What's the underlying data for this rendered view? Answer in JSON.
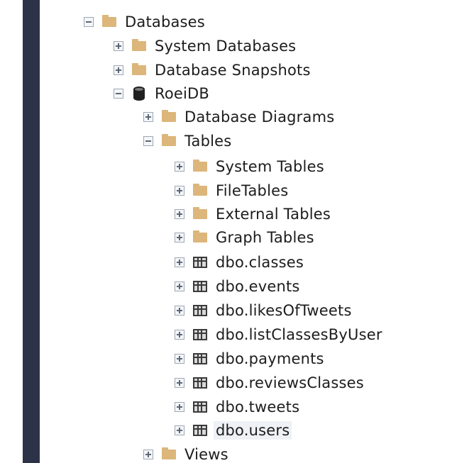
{
  "tree": {
    "databases": {
      "label": "Databases",
      "expanded": true,
      "icon": "folder-icon"
    },
    "system_databases": {
      "label": "System Databases",
      "expanded": false,
      "icon": "folder-icon"
    },
    "database_snapshots": {
      "label": "Database Snapshots",
      "expanded": false,
      "icon": "folder-icon"
    },
    "roeidb": {
      "label": "RoeiDB",
      "expanded": true,
      "icon": "database-icon"
    },
    "database_diagrams": {
      "label": "Database Diagrams",
      "expanded": false,
      "icon": "folder-icon"
    },
    "tables": {
      "label": "Tables",
      "expanded": true,
      "icon": "folder-icon"
    },
    "system_tables": {
      "label": "System Tables",
      "expanded": false,
      "icon": "folder-icon"
    },
    "file_tables": {
      "label": "FileTables",
      "expanded": false,
      "icon": "folder-icon"
    },
    "external_tables": {
      "label": "External Tables",
      "expanded": false,
      "icon": "folder-icon"
    },
    "graph_tables": {
      "label": "Graph Tables",
      "expanded": false,
      "icon": "folder-icon"
    },
    "user_tables": [
      {
        "label": "dbo.classes",
        "icon": "table-icon"
      },
      {
        "label": "dbo.events",
        "icon": "table-icon"
      },
      {
        "label": "dbo.likesOfTweets",
        "icon": "table-icon"
      },
      {
        "label": "dbo.listClassesByUser",
        "icon": "table-icon"
      },
      {
        "label": "dbo.payments",
        "icon": "table-icon"
      },
      {
        "label": "dbo.reviewsClasses",
        "icon": "table-icon"
      },
      {
        "label": "dbo.tweets",
        "icon": "table-icon"
      },
      {
        "label": "dbo.users",
        "icon": "table-icon",
        "selected": true
      }
    ],
    "views": {
      "label": "Views",
      "expanded": false,
      "icon": "folder-icon"
    }
  },
  "colors": {
    "folder": "#dcb67a",
    "left_bar": "#2c3247",
    "text": "#1c1c1c"
  }
}
